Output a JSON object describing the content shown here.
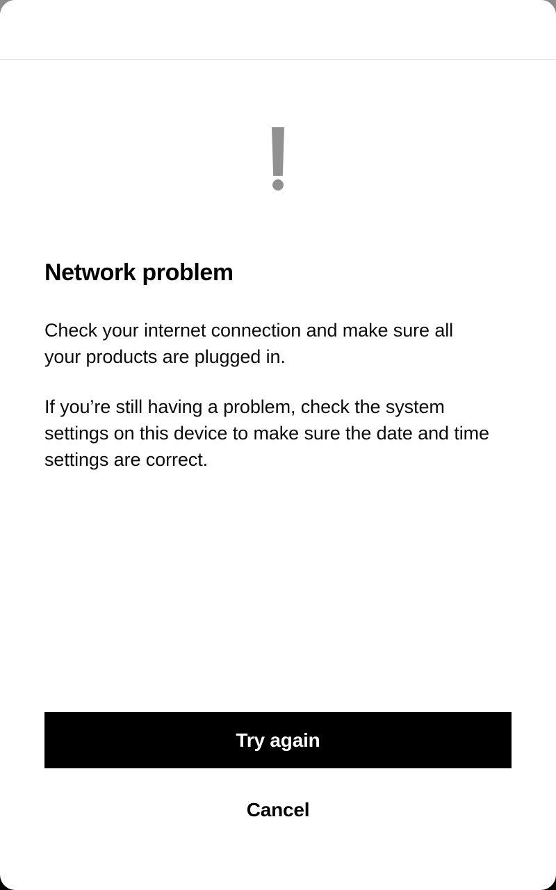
{
  "window": {
    "background_color": "#ffffff",
    "corner_backdrop_top_color": "#8c8c8c",
    "corner_backdrop_bottom_color": "#000000"
  },
  "topbar": {
    "title": "",
    "divider_color": "#e3e4e6"
  },
  "alert": {
    "icon": "exclamation-mark-icon",
    "icon_color": "#919191"
  },
  "content": {
    "title": "Network problem",
    "paragraph_1": "Check your internet connection and make sure all your products are plugged in.",
    "paragraph_2": "If you’re still having a problem, check the system settings on this device to make sure the date and time settings are correct.",
    "text_color": "#000000"
  },
  "actions": {
    "primary_label": "Try again",
    "primary_background": "#000000",
    "primary_text_color": "#ffffff",
    "secondary_label": "Cancel",
    "secondary_text_color": "#000000"
  }
}
